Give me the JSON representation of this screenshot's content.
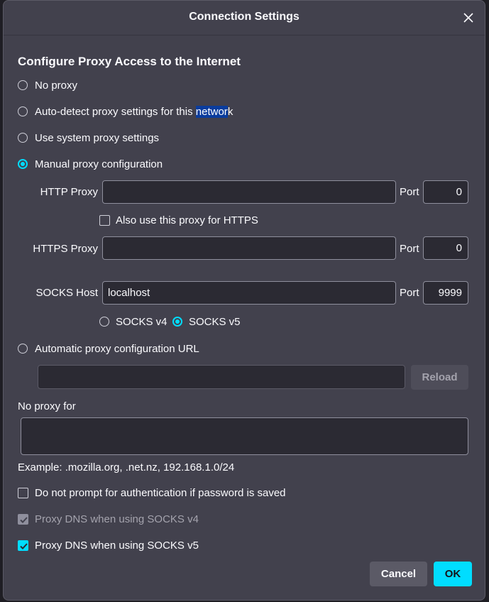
{
  "dialog": {
    "title": "Connection Settings"
  },
  "section_heading": "Configure Proxy Access to the Internet",
  "proxy_modes": {
    "no_proxy": "No proxy",
    "auto_detect_before": "Auto-detect proxy settings for this ",
    "auto_detect_selected": "networ",
    "auto_detect_after": "k",
    "system": "Use system proxy settings",
    "manual": "Manual proxy configuration",
    "auto_url": "Automatic proxy configuration URL",
    "selected": "manual"
  },
  "manual": {
    "http_label": "HTTP Proxy",
    "http_value": "",
    "http_port_label": "Port",
    "http_port": "0",
    "also_https_label": "Also use this proxy for HTTPS",
    "also_https_checked": false,
    "https_label": "HTTPS Proxy",
    "https_value": "",
    "https_port_label": "Port",
    "https_port": "0",
    "socks_label": "SOCKS Host",
    "socks_value": "localhost",
    "socks_port_label": "Port",
    "socks_port": "9999",
    "socks_v4": "SOCKS v4",
    "socks_v5": "SOCKS v5",
    "socks_selected": "v5"
  },
  "auto_url": {
    "value": "",
    "reload_label": "Reload"
  },
  "no_proxy_for": {
    "label": "No proxy for",
    "value": "",
    "example": "Example: .mozilla.org, .net.nz, 192.168.1.0/24"
  },
  "options": {
    "no_prompt_auth": "Do not prompt for authentication if password is saved",
    "no_prompt_auth_checked": false,
    "dns_v4": "Proxy DNS when using SOCKS v4",
    "dns_v4_checked": true,
    "dns_v5": "Proxy DNS when using SOCKS v5",
    "dns_v5_checked": true
  },
  "buttons": {
    "cancel": "Cancel",
    "ok": "OK"
  },
  "colors": {
    "accent": "#00ddff",
    "dialog_bg": "#42414d",
    "field_bg": "#2b2a33"
  }
}
